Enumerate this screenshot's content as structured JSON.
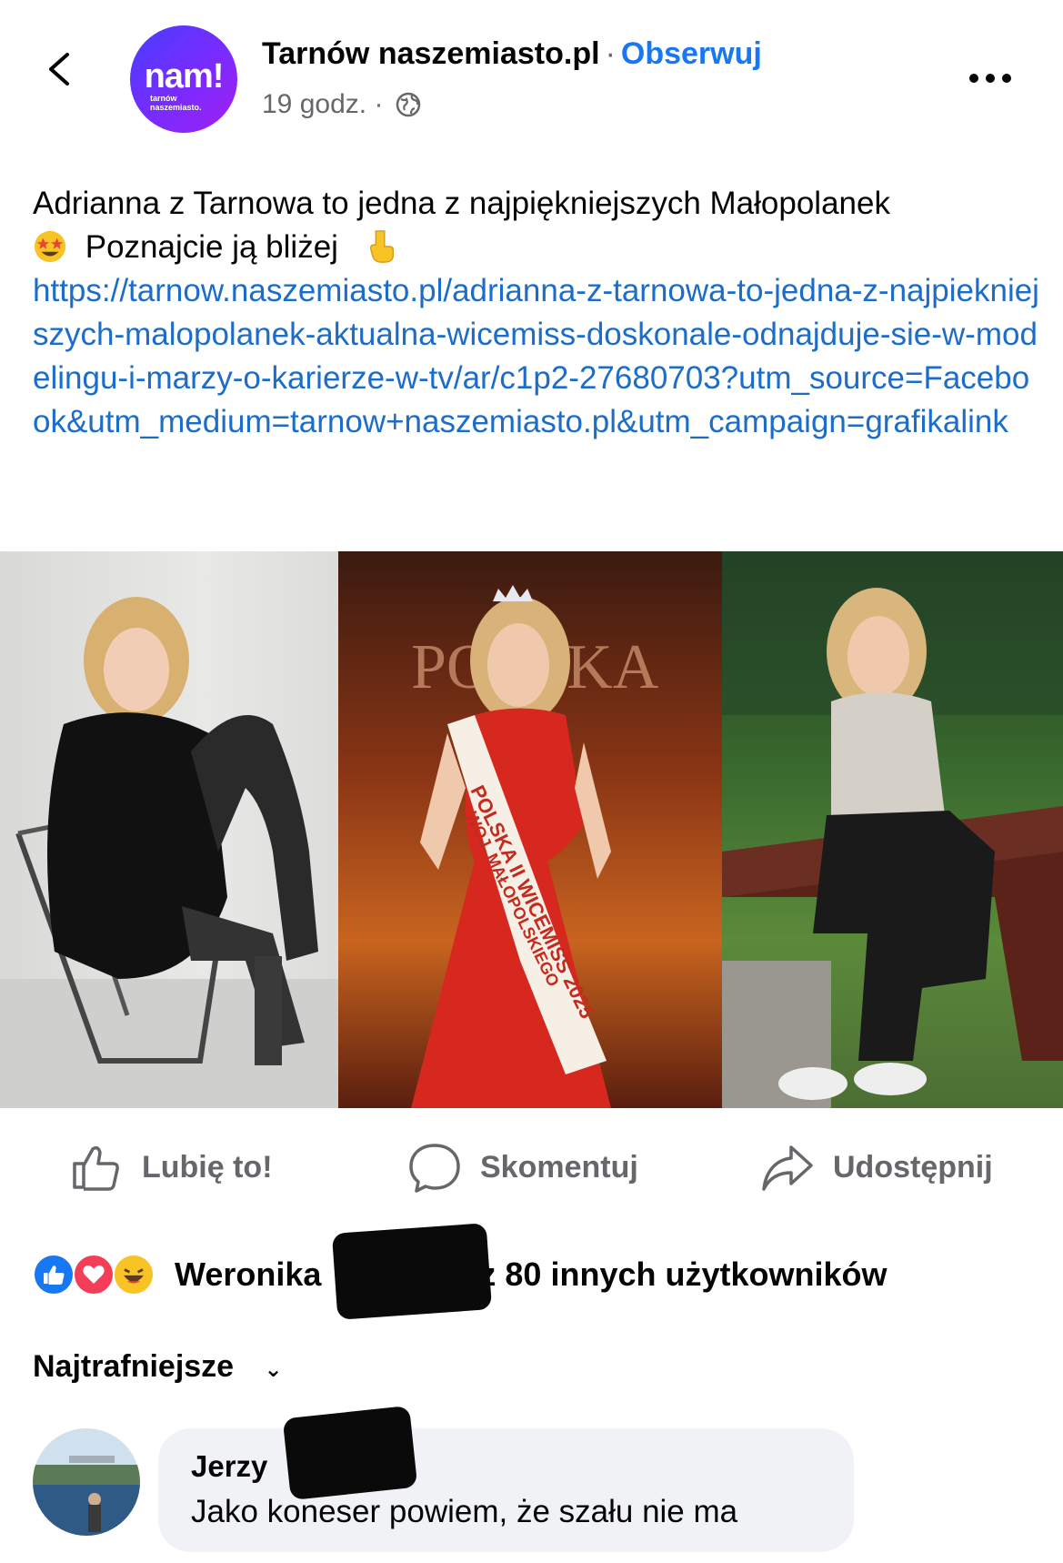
{
  "header": {
    "page_name": "Tarnów naszemiasto.pl",
    "separator": "·",
    "follow_label": "Obserwuj",
    "time": "19 godz.",
    "meta_dot": "·",
    "logo_word": "nam!",
    "logo_small_1": "tarnów",
    "logo_small_2": "naszemiasto."
  },
  "post": {
    "text_line1": "Adrianna z Tarnowa to jedna z najpiękniejszych Małopolanek",
    "text_line2": "Poznajcie ją bliżej",
    "link": "https://tarnow.naszemiasto.pl/adrianna-z-tarnowa-to-jedna-z-najpiekniejszych-malopolanek-aktualna-wicemiss-doskonale-odnajduje-sie-w-modelingu-i-marzy-o-karierze-w-tv/ar/c1p2-27680703?utm_source=Facebook&utm_medium=tarnow+naszemiasto.pl&utm_campaign=grafikalink",
    "sash_line1": "POLSKA II WICEMISS 2025",
    "sash_line2": "WOJ. MAŁOPOLSKIEGO",
    "banner_text": "POLSKA"
  },
  "actions": {
    "like_label": "Lubię to!",
    "comment_label": "Skomentuj",
    "share_label": "Udostępnij"
  },
  "reactions": {
    "text_name": "Weronika",
    "text_rest": "oraz 80 innych użytkowników"
  },
  "comments": {
    "sort_label": "Najtrafniejsze",
    "items": [
      {
        "author": "Jerzy",
        "text": "Jako koneser powiem, że szału nie ma"
      }
    ]
  },
  "colors": {
    "accent": "#1877f2",
    "link": "#1c6dc9",
    "secondary_text": "#65676b",
    "bubble": "#f0f2f5"
  },
  "icons": [
    "back-arrow-icon",
    "globe-icon",
    "more-icon",
    "star-struck-emoji-icon",
    "pointing-down-emoji-icon",
    "like-icon",
    "comment-icon",
    "share-icon",
    "like-reaction-icon",
    "love-reaction-icon",
    "haha-reaction-icon",
    "chevron-down-icon"
  ]
}
